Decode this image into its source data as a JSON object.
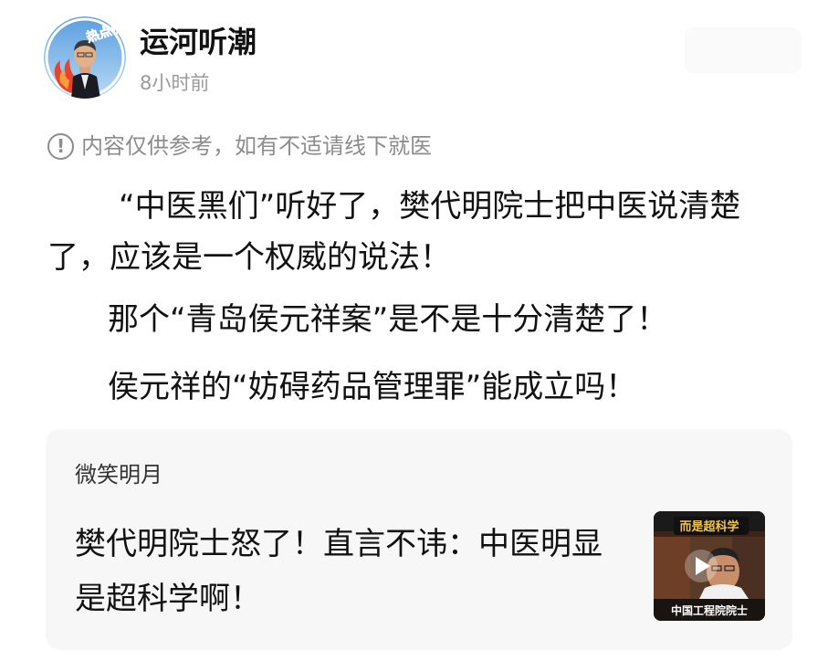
{
  "post": {
    "author_name": "运河听潮",
    "time_ago": "8小时前",
    "avatar_badge": "热点侠"
  },
  "disclaimer": {
    "icon": "info-circle-icon",
    "text": "内容仅供参考，如有不适请线下就医"
  },
  "body": {
    "paragraph_1": "“中医黑们”听好了，樊代明院士把中医说清楚了，应该是一个权威的说法！",
    "paragraph_2": "那个“青岛侯元祥案”是不是十分清楚了！",
    "paragraph_3": "侯元祥的“妨碍药品管理罪”能成立吗！"
  },
  "quoted_article": {
    "author": "微笑明月",
    "title": "樊代明院士怒了！直言不讳：中医明显是超科学啊！",
    "thumbnail": {
      "top_caption": "而是超科学",
      "bottom_caption": "中国工程院院士",
      "play_icon": "play-icon"
    }
  },
  "colors": {
    "secondary_text": "#9a9a9a",
    "card_background": "#f7f7f7",
    "thumbnail_caption": "#f3c54a"
  }
}
